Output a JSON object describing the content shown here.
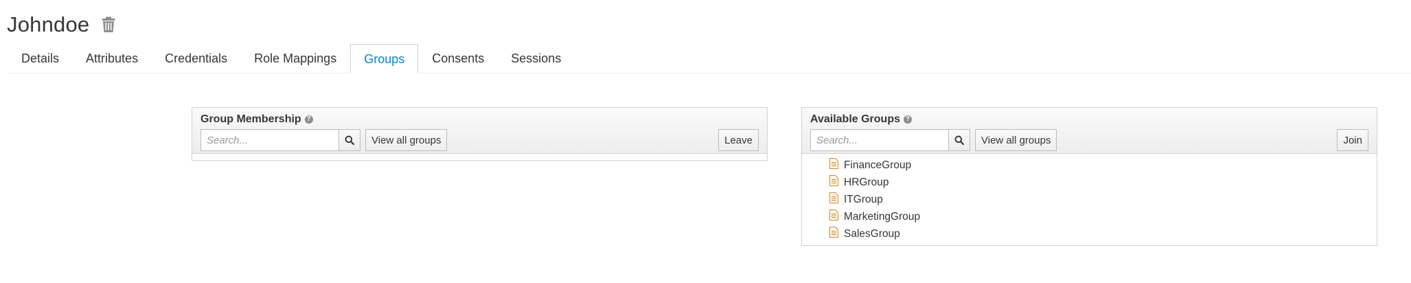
{
  "user": {
    "name": "Johndoe"
  },
  "tabs": [
    {
      "label": "Details"
    },
    {
      "label": "Attributes"
    },
    {
      "label": "Credentials"
    },
    {
      "label": "Role Mappings"
    },
    {
      "label": "Groups"
    },
    {
      "label": "Consents"
    },
    {
      "label": "Sessions"
    }
  ],
  "active_tab": "Groups",
  "membership": {
    "title": "Group Membership",
    "search_placeholder": "Search...",
    "view_all_label": "View all groups",
    "leave_label": "Leave",
    "groups": []
  },
  "available": {
    "title": "Available Groups",
    "search_placeholder": "Search...",
    "view_all_label": "View all groups",
    "join_label": "Join",
    "groups": [
      {
        "name": "FinanceGroup"
      },
      {
        "name": "HRGroup"
      },
      {
        "name": "ITGroup"
      },
      {
        "name": "MarketingGroup"
      },
      {
        "name": "SalesGroup"
      }
    ]
  },
  "colors": {
    "accent": "#0088ce",
    "text": "#363636",
    "border": "#d1d1d1",
    "doc_icon": "#d08a30"
  },
  "icons": {
    "delete": "trash-icon",
    "search": "search-icon",
    "help": "help-icon",
    "group": "document-icon"
  }
}
